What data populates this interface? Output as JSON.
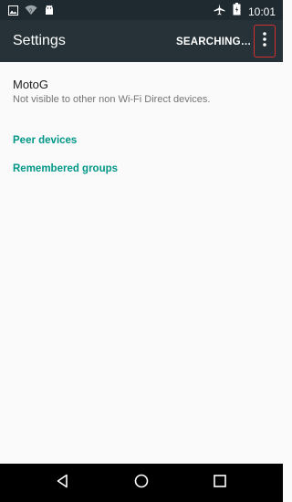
{
  "status_bar": {
    "time": "10:01",
    "icons_left": [
      "image-icon",
      "wifi-question-icon",
      "android-icon"
    ],
    "icons_right": [
      "airplane-icon",
      "battery-icon"
    ]
  },
  "app_bar": {
    "title": "Settings",
    "action": "SEARCHING…",
    "overflow_icon": "overflow-menu-icon",
    "highlight_color": "#d32f2f"
  },
  "device": {
    "name": "MotoG",
    "visibility": "Not visible to other non Wi-Fi Direct devices."
  },
  "sections": {
    "peer_devices": "Peer devices",
    "remembered_groups": "Remembered groups"
  },
  "nav_bar": {
    "icons": [
      "back-icon",
      "home-icon",
      "recents-icon"
    ]
  },
  "colors": {
    "accent": "#009688",
    "app_bar": "#263238",
    "status_bar": "#1f2a30"
  }
}
